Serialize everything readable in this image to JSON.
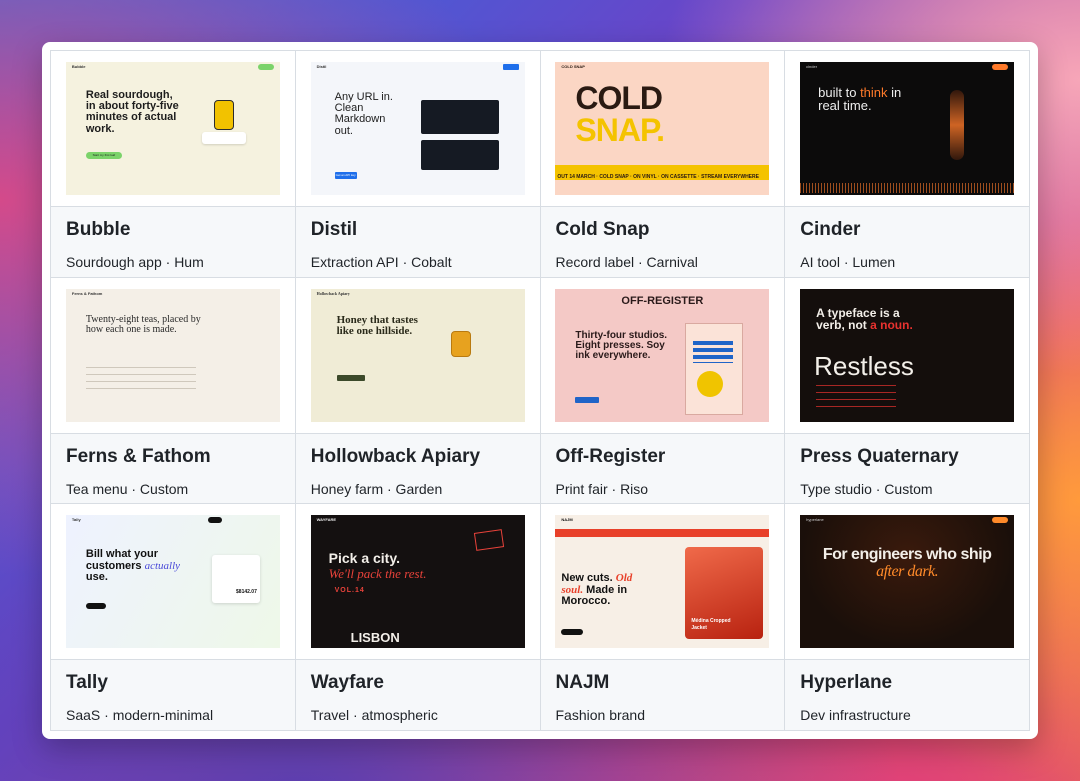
{
  "cards": [
    {
      "title": "Bubble",
      "subtitle": "Sourdough app · Hum",
      "thumb": {
        "brand": "Bubble",
        "headline": "Real sourdough, in about forty-five minutes of actual work.",
        "cta": "Start my first loaf",
        "bg": "#f5f2df",
        "accent": "#f2c200"
      }
    },
    {
      "title": "Distil",
      "subtitle": "Extraction API · Cobalt",
      "thumb": {
        "brand": "Distil",
        "headline": "Any URL in. Clean Markdown out.",
        "cta": "Get an API key",
        "bg": "#f4f6fa",
        "accent": "#1f6feb"
      }
    },
    {
      "title": "Cold Snap",
      "subtitle": "Record label · Carnival",
      "thumb": {
        "brand": "COLD SNAP",
        "headline_1": "COLD",
        "headline_2": "SNAP.",
        "ticker": "OUT 14 MARCH · COLD SNAP · ON VINYL · ON CASSETTE · STREAM EVERYWHERE",
        "bg": "#fbd6c4",
        "accent": "#f4c300"
      }
    },
    {
      "title": "Cinder",
      "subtitle": "AI tool · Lumen",
      "thumb": {
        "brand": "cinder",
        "headline_1": "built to",
        "headline_em": "think",
        "headline_2": "in real time.",
        "bg": "#0c0b0b",
        "accent": "#ff7a2a"
      }
    },
    {
      "title": "Ferns & Fathom",
      "subtitle": "Tea menu · Custom",
      "thumb": {
        "brand": "Ferns & Fathom",
        "headline": "Twenty-eight teas, placed by how each one is made.",
        "bg": "#f4efe7"
      }
    },
    {
      "title": "Hollowback Apiary",
      "subtitle": "Honey farm · Garden",
      "thumb": {
        "brand": "Hollowback Apiary",
        "headline": "Honey that tastes like one hillside.",
        "bg": "#f0ecd6",
        "accent": "#e7a21f"
      }
    },
    {
      "title": "Off-Register",
      "subtitle": "Print fair · Riso",
      "thumb": {
        "brand": "OFF-REGISTER",
        "headline": "Thirty-four studios. Eight presses. Soy ink everywhere.",
        "bg": "#f4c9c6",
        "accent": "#1f64c8"
      }
    },
    {
      "title": "Press Quaternary",
      "subtitle": "Type studio · Custom",
      "thumb": {
        "headline_1": "A typeface is a verb, not",
        "headline_em": "a noun.",
        "specimen": "Restless",
        "bg": "#140e0c",
        "accent": "#e8322f"
      }
    },
    {
      "title": "Tally",
      "subtitle": "SaaS · modern-minimal",
      "thumb": {
        "brand": "Tally",
        "headline_1": "Bill what your customers",
        "headline_em": "actually",
        "headline_2": "use.",
        "amount": "$8142.07",
        "bg": "#eef2f7"
      }
    },
    {
      "title": "Wayfare",
      "subtitle": "Travel · atmospheric",
      "thumb": {
        "brand": "WAYFARE",
        "headline_1": "Pick a city.",
        "headline_em": "We'll pack the rest.",
        "vol": "VOL.14",
        "city": "LISBON",
        "bg": "#141010",
        "accent": "#e8423a"
      }
    },
    {
      "title": "NAJM",
      "subtitle": "Fashion brand",
      "thumb": {
        "brand": "NAJM",
        "headline_1": "New cuts.",
        "headline_em": "Old soul.",
        "headline_2": "Made in Morocco.",
        "product": "Médina Cropped Jacket",
        "bg": "#f7efe6",
        "accent": "#e8402a"
      }
    },
    {
      "title": "Hyperlane",
      "subtitle": "Dev infrastructure",
      "thumb": {
        "brand": "hyperlane",
        "headline_1": "For engineers who ship",
        "headline_em": "after dark.",
        "bg": "#1a0f0a",
        "accent": "#ff8a2a"
      }
    }
  ]
}
